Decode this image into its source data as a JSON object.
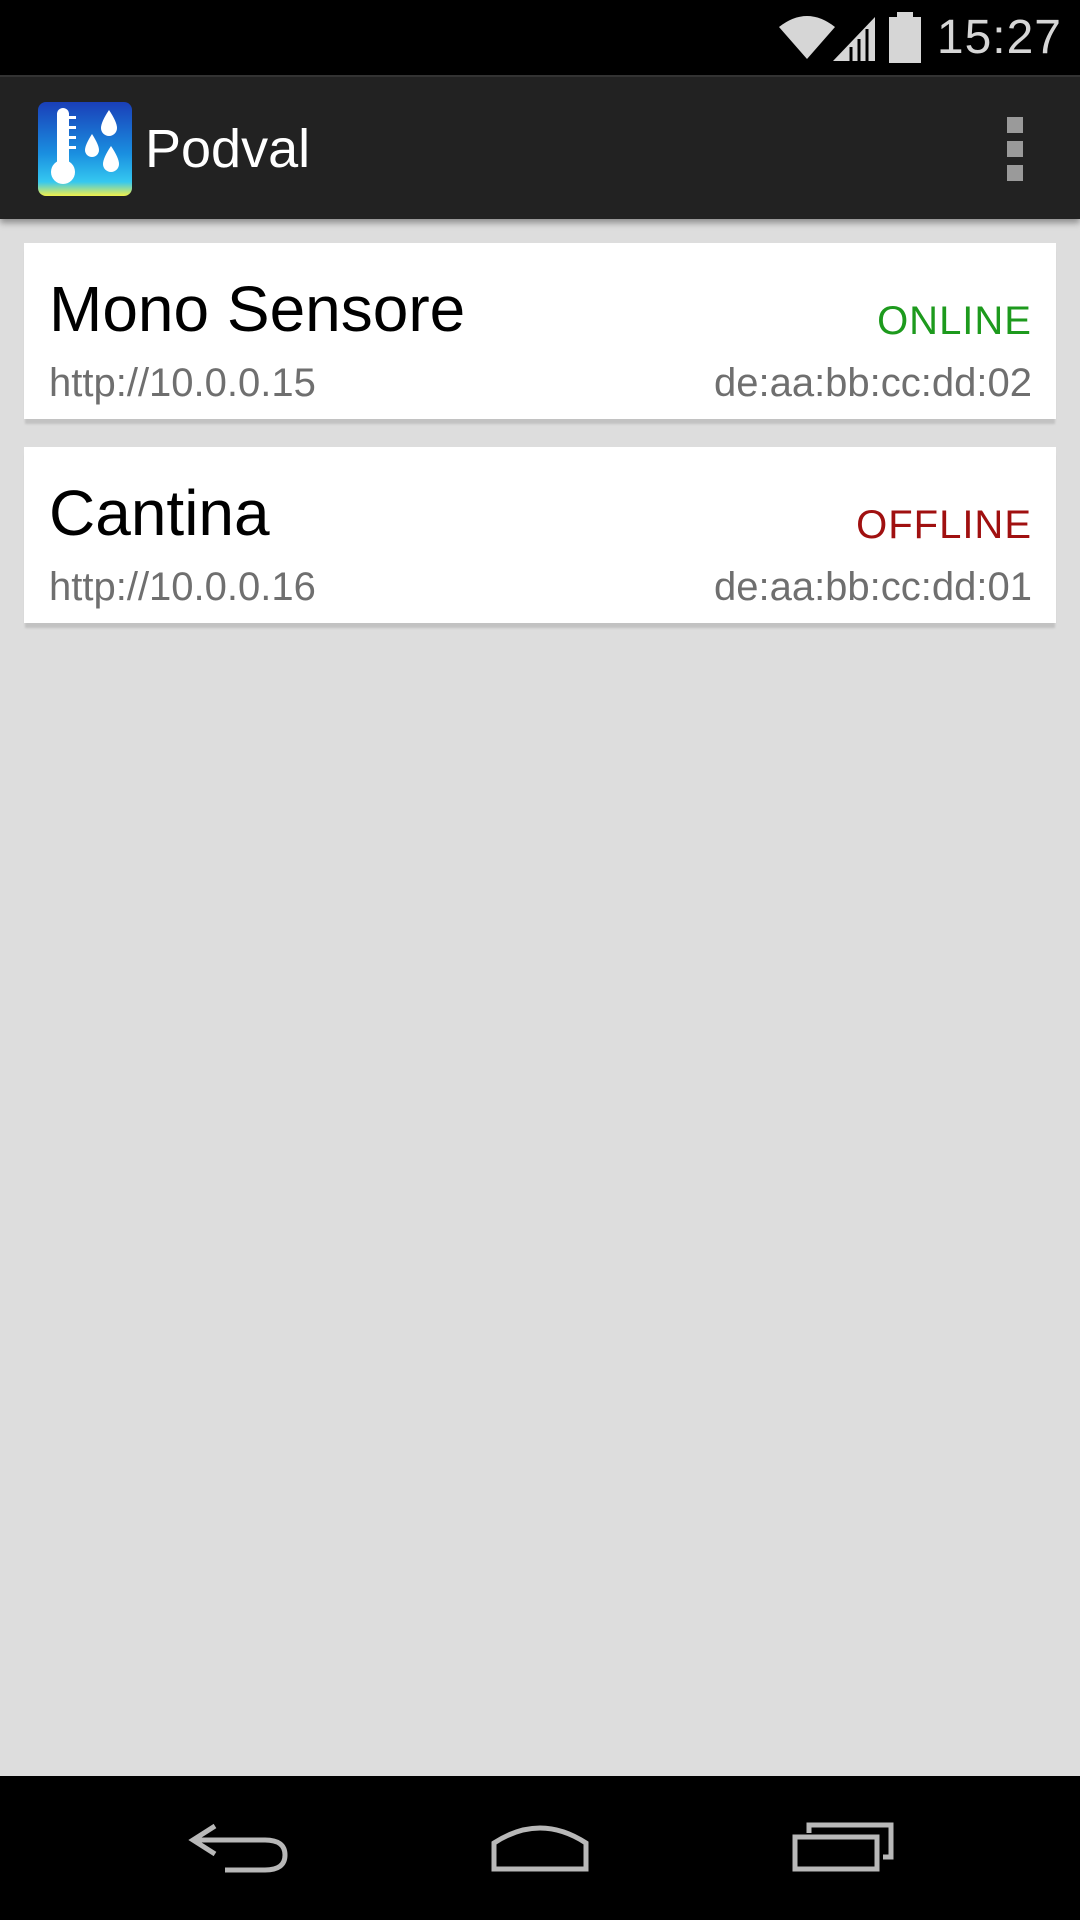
{
  "status_bar": {
    "time": "15:27",
    "icons": [
      "wifi-icon",
      "cell-signal-icon",
      "battery-icon"
    ]
  },
  "action_bar": {
    "title": "Podval",
    "app_icon": "thermometer-humidity-icon",
    "menu_icon": "overflow-menu-icon"
  },
  "devices": [
    {
      "name": "Mono Sensore",
      "status": "ONLINE",
      "status_color": "#1d9a1d",
      "url": "http://10.0.0.15",
      "mac": "de:aa:bb:cc:dd:02"
    },
    {
      "name": "Cantina",
      "status": "OFFLINE",
      "status_color": "#a01010",
      "url": "http://10.0.0.16",
      "mac": "de:aa:bb:cc:dd:01"
    }
  ],
  "nav_bar": {
    "buttons": [
      "back-icon",
      "home-icon",
      "recents-icon"
    ]
  },
  "colors": {
    "background": "#dddddd",
    "action_bar": "#222222",
    "online": "#1d9a1d",
    "offline": "#a01010"
  }
}
